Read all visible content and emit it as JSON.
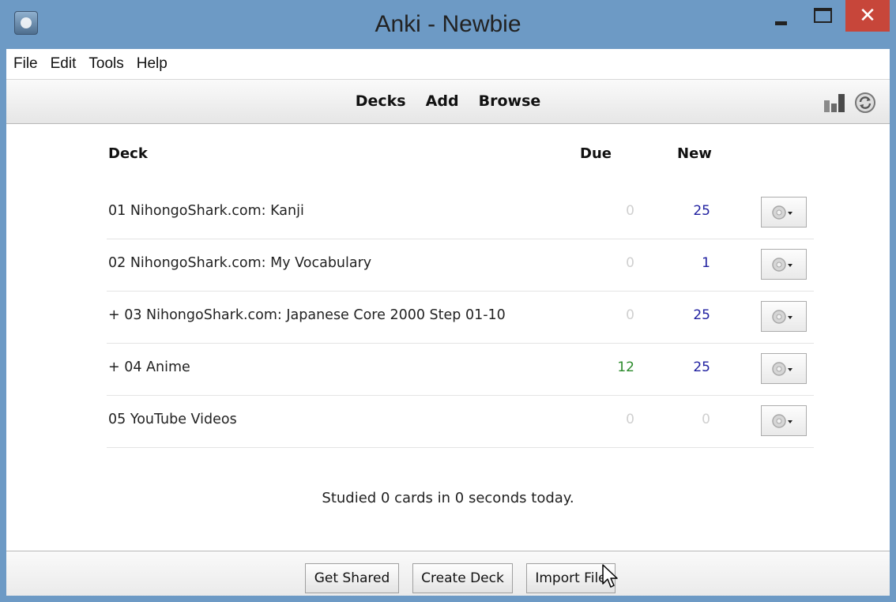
{
  "window": {
    "title": "Anki - Newbie",
    "close_glyph": "✕"
  },
  "menu": [
    "File",
    "Edit",
    "Tools",
    "Help"
  ],
  "toolbar": {
    "links": [
      "Decks",
      "Add",
      "Browse"
    ],
    "icons": [
      "stats-icon",
      "sync-icon"
    ]
  },
  "deck_table": {
    "headers": {
      "deck": "Deck",
      "due": "Due",
      "new": "New"
    },
    "rows": [
      {
        "name": "01 NihongoShark.com: Kanji",
        "due": "0",
        "new": "25"
      },
      {
        "name": "02 NihongoShark.com: My Vocabulary",
        "due": "0",
        "new": "1"
      },
      {
        "name": "+ 03 NihongoShark.com: Japanese Core 2000 Step 01-10",
        "due": "0",
        "new": "25"
      },
      {
        "name": "+ 04 Anime",
        "due": "12",
        "new": "25"
      },
      {
        "name": "05 YouTube Videos",
        "due": "0",
        "new": "0"
      }
    ]
  },
  "studied_text": "Studied 0 cards in 0 seconds today.",
  "bottom_buttons": {
    "get_shared": "Get Shared",
    "create_deck": "Create Deck",
    "import_file": "Import File"
  },
  "colors": {
    "titlebar": "#6d9ac5",
    "close_button": "#c7463a",
    "due_count": "#2a8a2a",
    "new_count": "#2020a0",
    "zero_count": "#d0d0d0"
  }
}
